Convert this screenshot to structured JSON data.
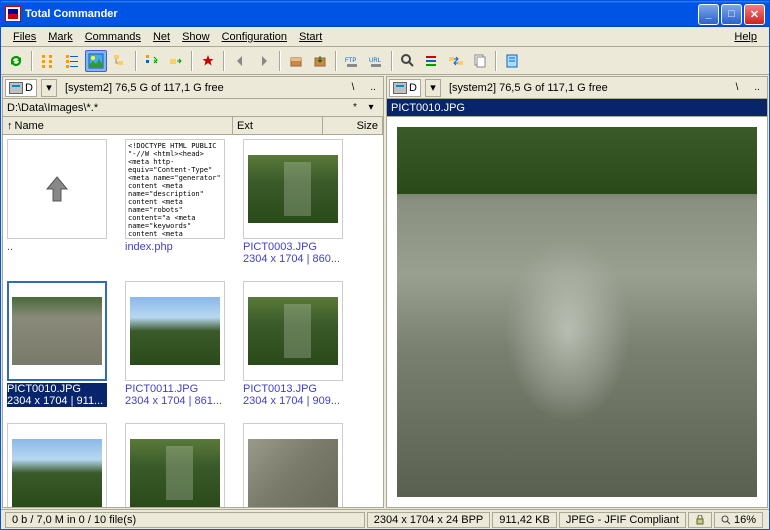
{
  "window": {
    "title": "Total Commander"
  },
  "menu": {
    "files": "Files",
    "mark": "Mark",
    "commands": "Commands",
    "net": "Net",
    "show": "Show",
    "configuration": "Configuration",
    "start": "Start",
    "help": "Help"
  },
  "left": {
    "drive": "D",
    "free": "[system2]  76,5 G of 117,1 G free",
    "path": "D:\\Data\\Images\\*.*",
    "cols": {
      "name": "Name",
      "ext": "Ext",
      "size": "Size"
    },
    "thumbs": [
      {
        "name": "..",
        "info": "",
        "kind": "up"
      },
      {
        "name": "index.php",
        "info": "",
        "kind": "code"
      },
      {
        "name": "PICT0003.JPG",
        "info": "2304 x 1704 | 860...",
        "kind": "forest"
      },
      {
        "name": "PICT0010.JPG",
        "info": "2304 x 1704 | 911...",
        "kind": "rock",
        "selected": true
      },
      {
        "name": "PICT0011.JPG",
        "info": "2304 x 1704 | 861...",
        "kind": "mountain"
      },
      {
        "name": "PICT0013.JPG",
        "info": "2304 x 1704 | 909...",
        "kind": "forest"
      },
      {
        "name": "",
        "info": "",
        "kind": "mountain"
      },
      {
        "name": "",
        "info": "",
        "kind": "forest"
      },
      {
        "name": "",
        "info": "",
        "kind": "ruins"
      }
    ],
    "status": "0 b / 7,0 M in 0 / 10 file(s)"
  },
  "right": {
    "drive": "D",
    "free": "[system2]  76,5 G of 117,1 G free",
    "path": "PICT0010.JPG",
    "status": {
      "dim": "2304 x 1704 x 24 BPP",
      "size": "911,42 KB",
      "format": "JPEG - JFIF Compliant",
      "zoom": "16%"
    }
  },
  "code_preview": "<!DOCTYPE HTML PUBLIC \"-//W\n<html><head>\n<meta http-equiv=\"Content-Type\"\n<meta name=\"generator\" content\n<meta name=\"description\" content\n<meta name=\"robots\" content=\"a\n<meta name=\"keywords\" content\n<meta name=\"language\" content\n<title>Title of Page</title>\n\n<script src=\"/_inc/funcs.js\" type\n<style type=\"text/css\">@import"
}
